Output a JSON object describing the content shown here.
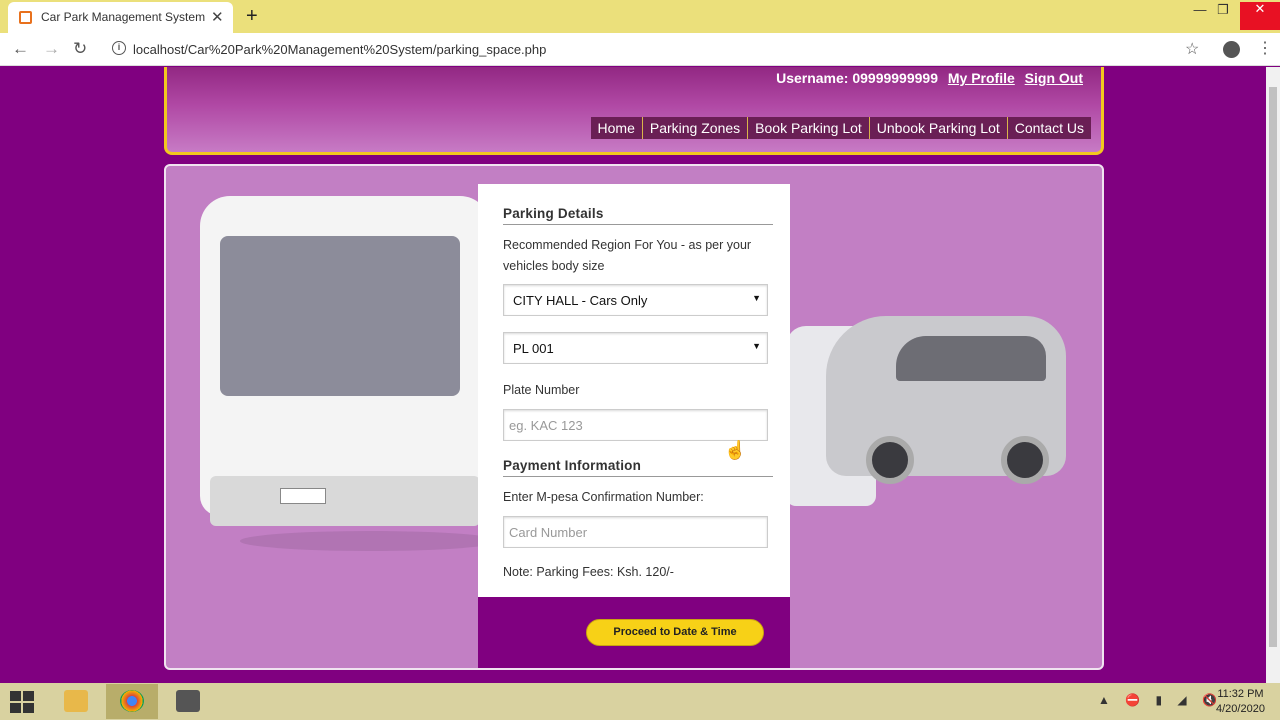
{
  "browser": {
    "tab_title": "Car Park Management System",
    "url": "localhost/Car%20Park%20Management%20System/parking_space.php",
    "icons": [
      "back-icon",
      "forward-icon",
      "reload-icon",
      "info-icon",
      "star-icon",
      "account-icon",
      "menu-icon",
      "close-icon",
      "plus-icon"
    ]
  },
  "header": {
    "username_text": "Username: 09999999999",
    "my_profile": "My Profile",
    "sign_out": "Sign Out",
    "nav": [
      "Home",
      "Parking Zones",
      "Book Parking Lot",
      "Unbook Parking Lot",
      "Contact Us"
    ]
  },
  "form": {
    "parking_title": "Parking Details",
    "recommend_text": "Recommended Region For You - as per your vehicles body size",
    "region_select": "CITY HALL - Cars Only",
    "lot_select": "PL 001",
    "plate_label": "Plate Number",
    "plate_placeholder": "eg. KAC 123",
    "payment_title": "Payment Information",
    "mpesa_label": "Enter M-pesa Confirmation Number:",
    "card_placeholder": "Card Number",
    "note": "Note: Parking Fees: Ksh. 120/-",
    "proceed_button": "Proceed to Date & Time"
  },
  "taskbar": {
    "time": "11:32 PM",
    "date": "4/20/2020"
  },
  "colors": {
    "page_bg": "#800080",
    "accent_yellow": "#f7d117",
    "nav_bg": "#6a1f55",
    "tabbar": "#ebe07b"
  }
}
